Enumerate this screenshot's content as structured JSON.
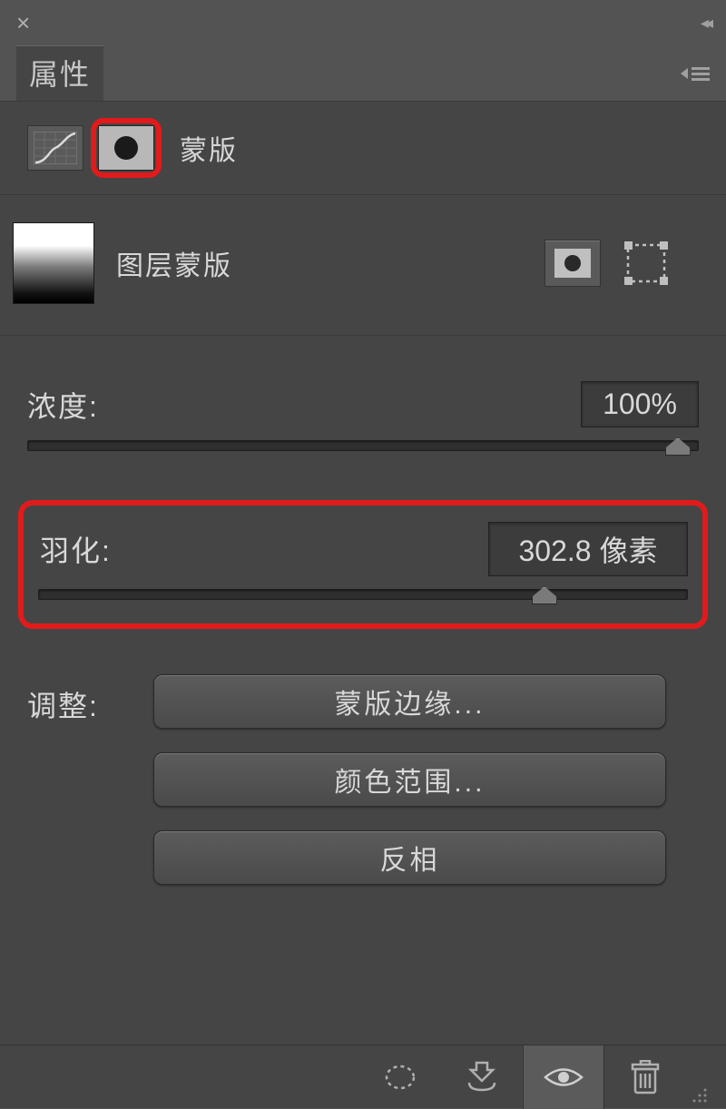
{
  "panel": {
    "title": "属性",
    "mask_tab_label": "蒙版"
  },
  "mask": {
    "type_label": "图层蒙版"
  },
  "sliders": {
    "density": {
      "label": "浓度:",
      "value": "100%",
      "pos_pct": 97
    },
    "feather": {
      "label": "羽化:",
      "value": "302.8 像素",
      "pos_pct": 78
    }
  },
  "adjust": {
    "label": "调整:",
    "buttons": {
      "mask_edge": "蒙版边缘...",
      "color_range": "颜色范围...",
      "invert": "反相"
    }
  }
}
